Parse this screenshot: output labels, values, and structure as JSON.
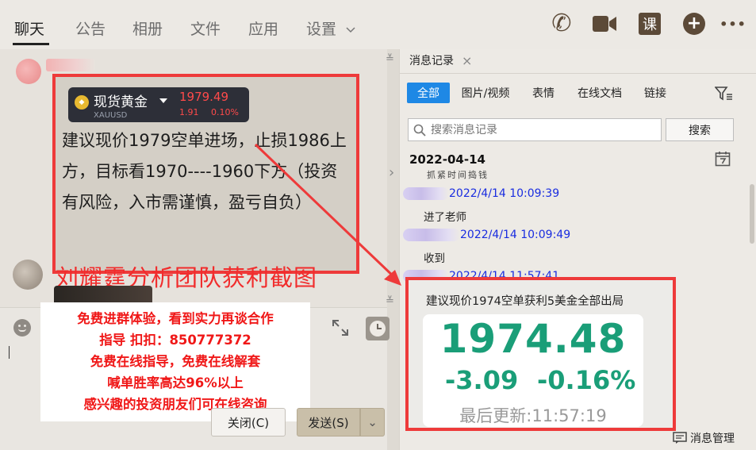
{
  "topbar": {
    "tabs": [
      "聊天",
      "公告",
      "相册",
      "文件",
      "应用",
      "设置"
    ],
    "call_glyph": "✆",
    "course_icon_label": "课",
    "plus_glyph": "+",
    "more_glyph": "•••"
  },
  "chat": {
    "quote_card": {
      "name": "现货黄金",
      "code": "XAUUSD",
      "price": "1979.49",
      "change": "1.91",
      "change_pct": "0.10%",
      "coin_glyph": "◆"
    },
    "message_text": "建议现价1979空单进场，止损1986上方，目标看1970----1960下方（投资有风险，入市需谨慎，盈亏自负）",
    "red_caption": "刘耀霆分析团队获利截图",
    "ad_lines": [
      "免费进群体验，看到实力再谈合作",
      "指导 扣扣：850777372",
      "免费在线指导，免费在线解套",
      "喊单胜率高达96%以上",
      "感兴趣的投资朋友们可在线咨询"
    ],
    "close_button": "关闭(C)",
    "send_button": "发送(S)",
    "collapse_glyph": "≚",
    "expand_glyph": "≚",
    "side_arrow_glyph": "›",
    "dropdown_glyph": "⌄"
  },
  "panel": {
    "tab_label": "消息记录",
    "tab_close_glyph": "×",
    "filters": [
      "全部",
      "图片/视频",
      "表情",
      "在线文档",
      "链接"
    ],
    "search_placeholder": "搜索消息记录",
    "search_button": "搜索",
    "date": "2022-04-14",
    "scribble": "抓紧时间捣钱",
    "messages": [
      {
        "time": "2022/4/14 10:09:39",
        "text": "进了老师"
      },
      {
        "time": "2022/4/14 10:09:49",
        "text": "收到"
      },
      {
        "time": "2022/4/14 11:57:41",
        "text": ""
      }
    ],
    "profit_text": "建议现价1974空单获利5美金全部出局",
    "price_card": {
      "price": "1974.48",
      "change": "-3.09",
      "change_pct": "-0.16%",
      "updated": "最后更新:11:57:19"
    },
    "msg_manage": "消息管理"
  },
  "colors": {
    "accent_blue": "#1e88e5",
    "alert_red": "#ee3a3a",
    "gain_green": "#1a9e78"
  }
}
